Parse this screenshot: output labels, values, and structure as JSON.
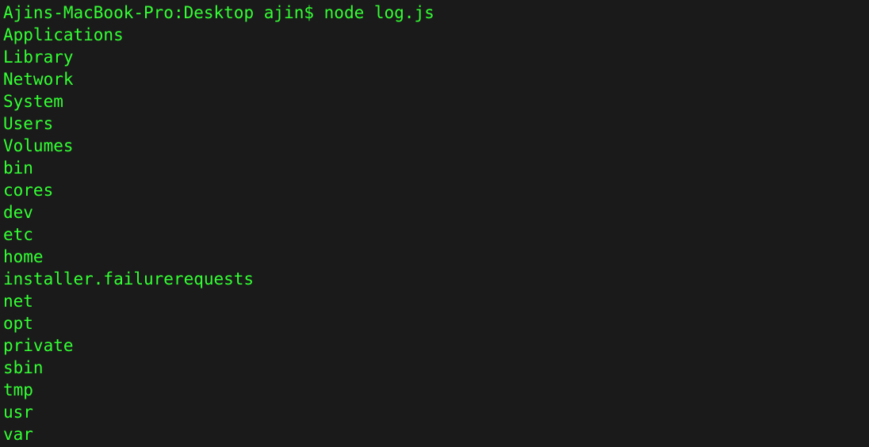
{
  "terminal": {
    "prompt": {
      "host": "Ajins-MacBook-Pro",
      "path": "Desktop",
      "user": "ajin",
      "symbol": "$"
    },
    "command": "node log.js",
    "output": [
      "Applications",
      "Library",
      "Network",
      "System",
      "Users",
      "Volumes",
      "bin",
      "cores",
      "dev",
      "etc",
      "home",
      "installer.failurerequests",
      "net",
      "opt",
      "private",
      "sbin",
      "tmp",
      "usr",
      "var"
    ]
  }
}
